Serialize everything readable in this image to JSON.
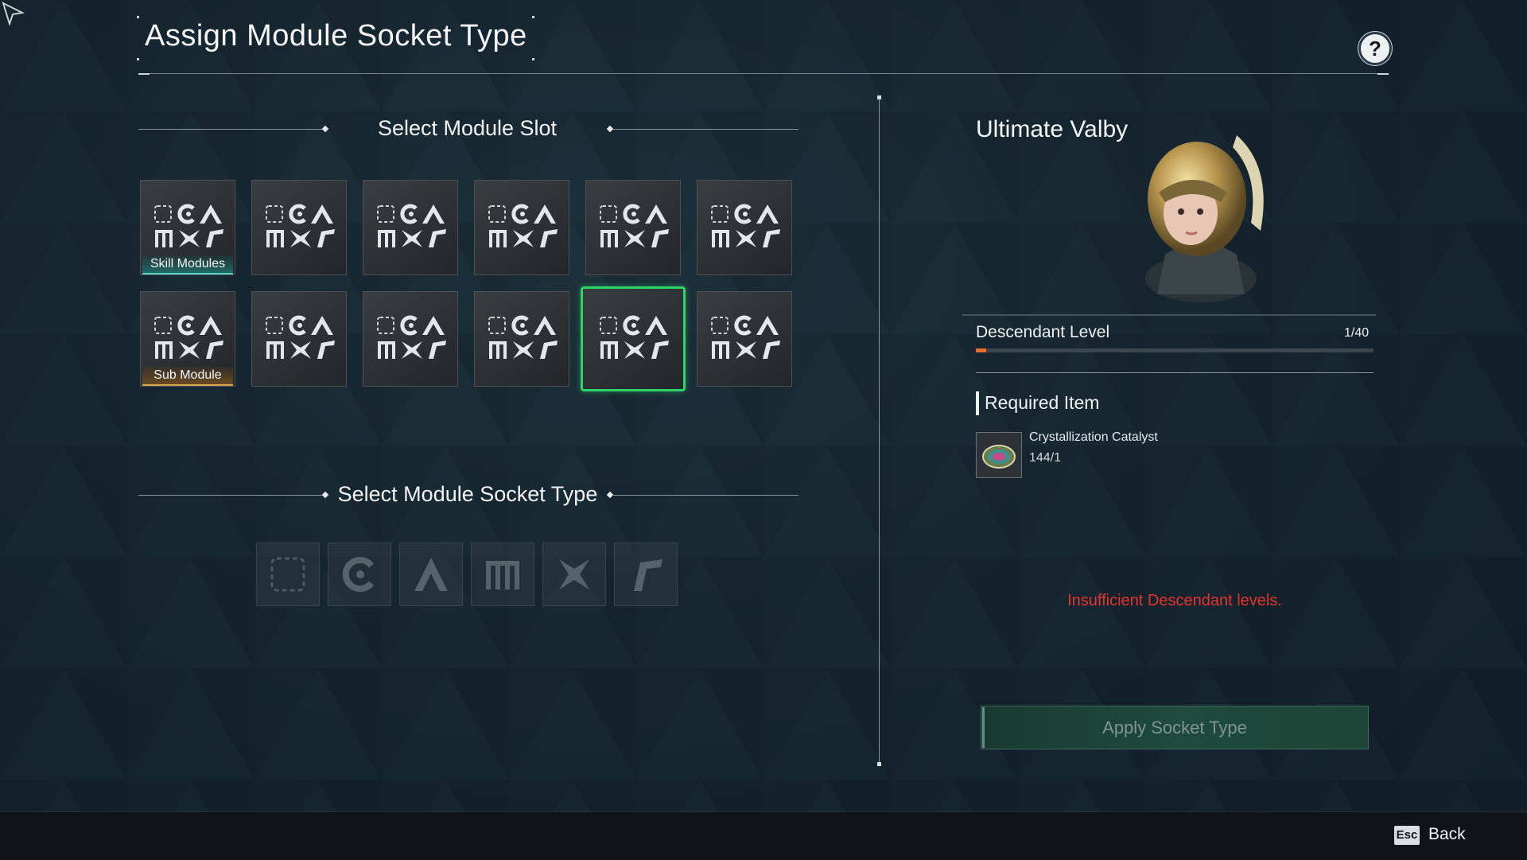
{
  "header": {
    "title": "Assign Module Socket Type",
    "help_label": "?"
  },
  "slots_section": {
    "title": "Select Module Slot",
    "skill_tag": "Skill Modules",
    "sub_tag": "Sub Module",
    "selected_slot": "row 2, column 5"
  },
  "socket_section": {
    "title": "Select Module Socket Type",
    "socket_types": [
      "blank-socket-icon",
      "cerulean-socket-icon",
      "almandine-socket-icon",
      "malachite-socket-icon",
      "xantic-socket-icon",
      "rutile-socket-icon"
    ]
  },
  "descendant": {
    "name": "Ultimate Valby",
    "level_label": "Descendant Level",
    "level_value": "1/40",
    "level_progress": 0.025
  },
  "required": {
    "title": "Required Item",
    "item_name": "Crystallization Catalyst",
    "item_count": "144/1"
  },
  "warning": "Insufficient Descendant levels.",
  "apply_button": "Apply Socket Type",
  "footer": {
    "esc_key": "Esc",
    "back_label": "Back"
  },
  "colors": {
    "selected_border": "#2ed36a",
    "warning": "#e8322d",
    "skill_tag": "#1e6a66",
    "sub_tag": "#6a4a22",
    "level_fill": "#ef6d2c"
  }
}
